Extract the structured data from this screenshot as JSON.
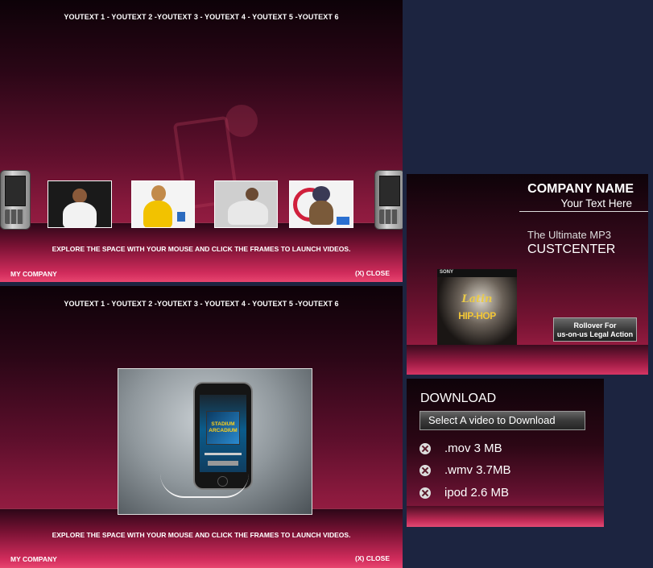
{
  "nav": {
    "text": "YOUTEXT 1 - YOUTEXT 2 -YOUTEXT 3 - YOUTEXT 4 - YOUTEXT 5 -YOUTEXT 6"
  },
  "gallery": {
    "instruction": "EXPLORE THE SPACE WITH YOUR MOUSE AND CLICK THE FRAMES TO LAUNCH VIDEOS.",
    "footer_left": "MY COMPANY",
    "footer_right": "(X) CLOSE"
  },
  "player": {
    "album_text": "STADIUM ARCADIUM"
  },
  "promo": {
    "company_name": "COMPANY NAME",
    "tagline": "Your Text Here",
    "line1": "The Ultimate MP3",
    "line2": "CUSTCENTER",
    "album_brand": "SONY",
    "album_title_1": "Latin",
    "album_title_2": "HIP-HOP",
    "rollover_line1": "Rollover For",
    "rollover_line2": "us-on-us Legal Action"
  },
  "download": {
    "title": "DOWNLOAD",
    "button_label": "Select A video to Download",
    "items": [
      {
        "label": ".mov 3 MB"
      },
      {
        "label": ".wmv 3.7MB"
      },
      {
        "label": "ipod 2.6 MB"
      }
    ]
  }
}
